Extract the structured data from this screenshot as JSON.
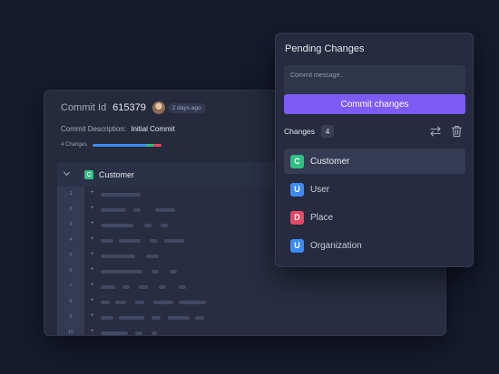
{
  "commit_view": {
    "id_label": "Commit Id",
    "id_value": "615379",
    "date_badge": "2 days ago",
    "description_label": "Commit Description:",
    "description_value": "Initial Commit",
    "changes_count": "4 Changes",
    "progress_segments": [
      {
        "fraction": 0.78,
        "color": "#3d8bf2"
      },
      {
        "fraction": 0.1,
        "color": "#2fbf83"
      },
      {
        "fraction": 0.12,
        "color": "#e04a63"
      }
    ],
    "file": {
      "badge": "C",
      "badge_color": "#2fbf83",
      "name": "Customer"
    },
    "line_numbers": [
      "1",
      "2",
      "3",
      "4",
      "5",
      "6",
      "7",
      "8",
      "9",
      "10"
    ],
    "line_marker": "+"
  },
  "pending": {
    "title": "Pending Changes",
    "input_placeholder": "Commit message..",
    "button_label": "Commit changes",
    "changes_label": "Changes",
    "changes_count": "4",
    "items": [
      {
        "badge": "C",
        "color": "#2fbf83",
        "name": "Customer",
        "selected": true
      },
      {
        "badge": "U",
        "color": "#3d8bf2",
        "name": "User",
        "selected": false
      },
      {
        "badge": "D",
        "color": "#e04a63",
        "name": "Place",
        "selected": false
      },
      {
        "badge": "U",
        "color": "#3d8bf2",
        "name": "Organization",
        "selected": false
      }
    ]
  }
}
